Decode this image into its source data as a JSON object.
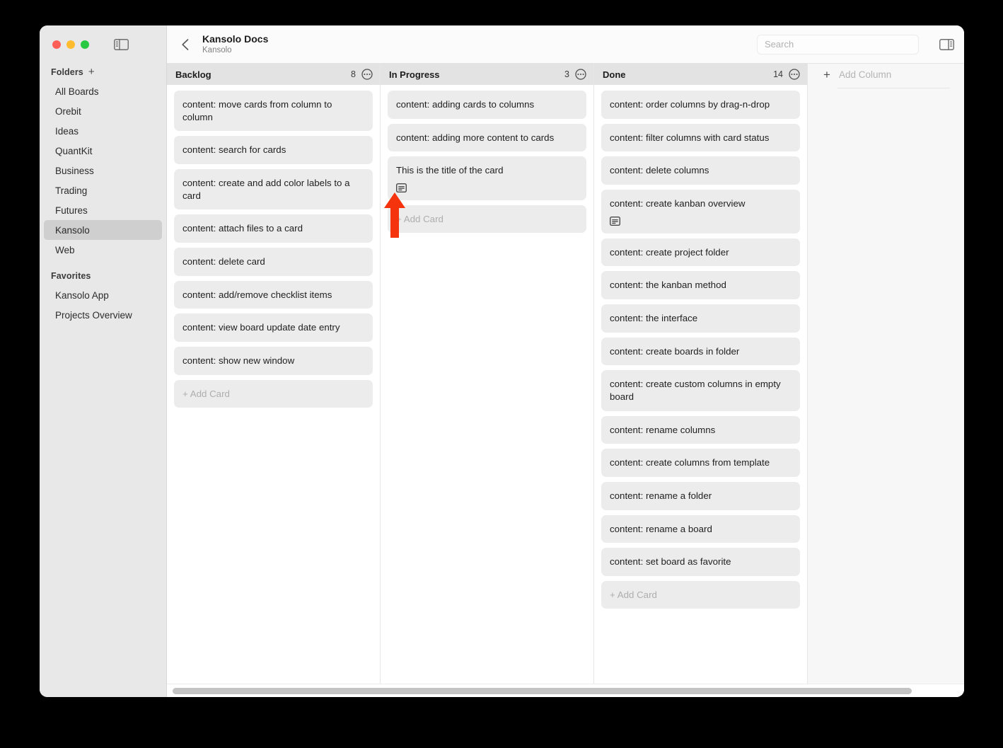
{
  "window": {
    "traffic_lights": [
      "close",
      "minimize",
      "zoom"
    ],
    "sidebar_toggle_icon": "left-panel-toggle-icon"
  },
  "sidebar": {
    "folders_label": "Folders",
    "folders_add_icon": "plus-icon",
    "folders": [
      {
        "label": "All Boards",
        "selected": false
      },
      {
        "label": "Orebit",
        "selected": false
      },
      {
        "label": "Ideas",
        "selected": false
      },
      {
        "label": "QuantKit",
        "selected": false
      },
      {
        "label": "Business",
        "selected": false
      },
      {
        "label": "Trading",
        "selected": false
      },
      {
        "label": "Futures",
        "selected": false
      },
      {
        "label": "Kansolo",
        "selected": true
      },
      {
        "label": "Web",
        "selected": false
      }
    ],
    "favorites_label": "Favorites",
    "favorites": [
      {
        "label": "Kansolo App"
      },
      {
        "label": "Projects Overview"
      }
    ]
  },
  "topbar": {
    "back_icon": "chevron-left-icon",
    "title": "Kansolo Docs",
    "subtitle": "Kansolo",
    "search_placeholder": "Search",
    "search_value": "",
    "right_panel_toggle_icon": "right-panel-toggle-icon"
  },
  "board": {
    "add_card_label": "+ Add Card",
    "add_column_label": "Add Column",
    "add_column_plus": "+",
    "column_menu_icon": "circle-ellipsis-icon",
    "description_badge_icon": "description-icon",
    "columns": [
      {
        "title": "Backlog",
        "count": "8",
        "cards": [
          {
            "title": "content: move cards from column to column",
            "has_description": false
          },
          {
            "title": "content: search for cards",
            "has_description": false
          },
          {
            "title": "content: create and add color labels to a card",
            "has_description": false
          },
          {
            "title": "content: attach files to a card",
            "has_description": false
          },
          {
            "title": "content: delete card",
            "has_description": false
          },
          {
            "title": "content: add/remove checklist items",
            "has_description": false
          },
          {
            "title": "content: view board update date entry",
            "has_description": false
          },
          {
            "title": "content: show new window",
            "has_description": false
          }
        ]
      },
      {
        "title": "In Progress",
        "count": "3",
        "cards": [
          {
            "title": "content: adding cards to columns",
            "has_description": false
          },
          {
            "title": "content: adding more content to cards",
            "has_description": false
          },
          {
            "title": "This is the title of the card",
            "has_description": true
          }
        ]
      },
      {
        "title": "Done",
        "count": "14",
        "cards": [
          {
            "title": "content: order columns by drag-n-drop",
            "has_description": false
          },
          {
            "title": "content: filter columns with card status",
            "has_description": false
          },
          {
            "title": "content: delete columns",
            "has_description": false
          },
          {
            "title": "content: create kanban overview",
            "has_description": true
          },
          {
            "title": "content: create project folder",
            "has_description": false
          },
          {
            "title": "content: the kanban method",
            "has_description": false
          },
          {
            "title": "content: the interface",
            "has_description": false
          },
          {
            "title": "content: create boards in folder",
            "has_description": false
          },
          {
            "title": "content: create custom columns in empty board",
            "has_description": false
          },
          {
            "title": "content: rename columns",
            "has_description": false
          },
          {
            "title": "content: create columns from template",
            "has_description": false
          },
          {
            "title": "content: rename a folder",
            "has_description": false
          },
          {
            "title": "content: rename a board",
            "has_description": false
          },
          {
            "title": "content: set board as favorite",
            "has_description": false
          }
        ]
      }
    ]
  },
  "annotation": {
    "arrow_color": "#f5330c",
    "arrow_points_to": "add-card-in-progress"
  },
  "colors": {
    "sidebar_bg": "#e8e8e8",
    "selected_item": "#cfcfcf",
    "card_bg": "#ececec",
    "column_header_bg": "#e3e3e3",
    "placeholder_text": "#b1b1b1",
    "accent_red": "#f5330c",
    "caret_blue": "#2d6fe0"
  }
}
